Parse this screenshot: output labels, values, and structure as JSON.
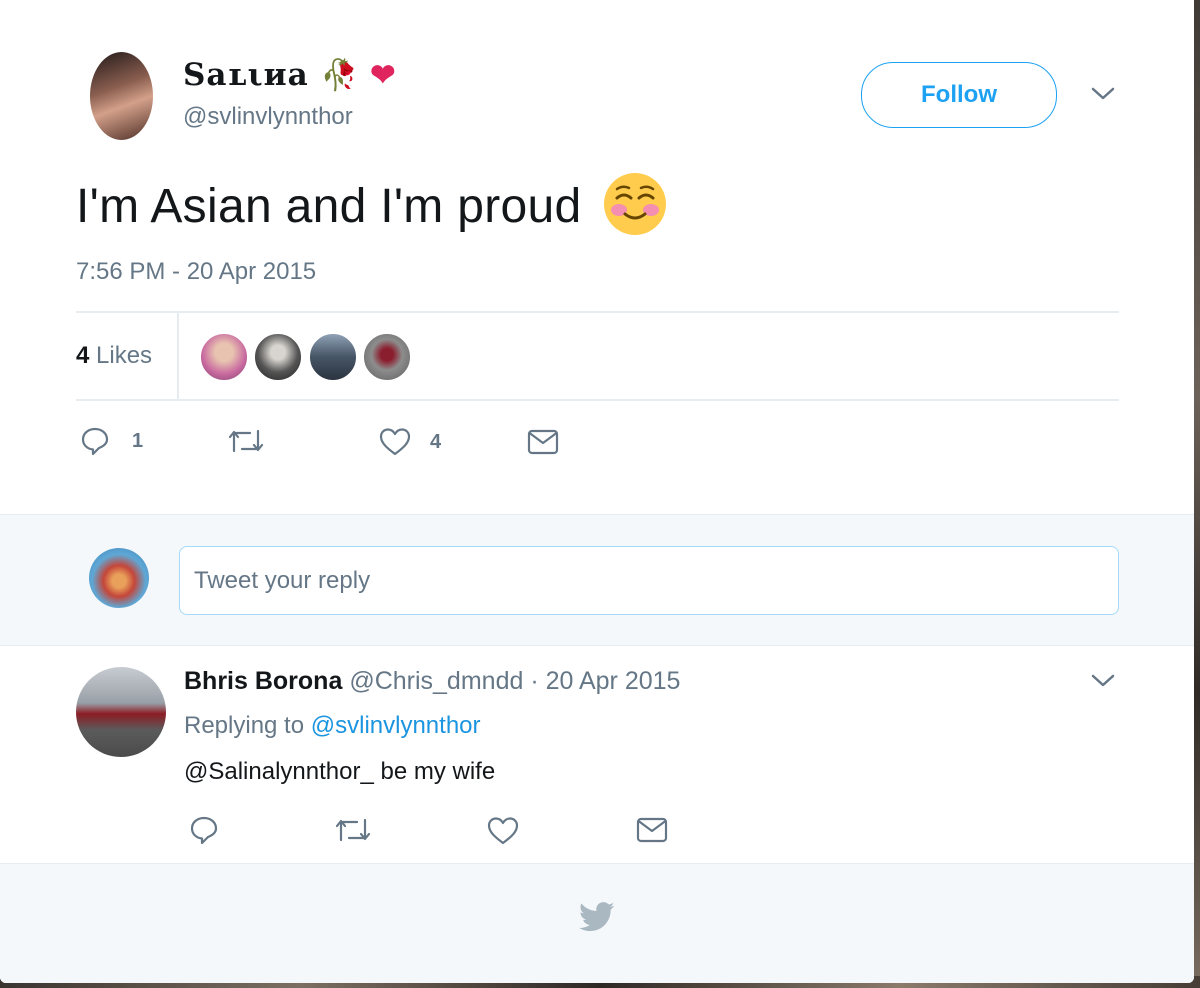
{
  "tweet": {
    "author_name": "Saʟιиa",
    "author_emoji": "🥀 ❤",
    "handle": "@svlinvlynnthor",
    "follow_label": "Follow",
    "text": "I'm Asian and I'm proud",
    "text_emoji": "☺️",
    "timestamp": "7:56 PM - 20 Apr 2015",
    "likes_count": "4",
    "likes_label": "Likes",
    "actions": {
      "reply_count": "1",
      "retweet_count": "",
      "like_count": "4"
    }
  },
  "reply_box": {
    "placeholder": "Tweet your reply"
  },
  "reply": {
    "author_name": "Bhris Borona",
    "handle": "@Chris_dmndd",
    "date": "· 20 Apr 2015",
    "replying_prefix": "Replying to",
    "replying_to": "@svlinvlynnthor",
    "text": "@Salinalynnthor_ be my wife"
  },
  "colors": {
    "accent": "#1da1f2",
    "muted": "#657786",
    "border": "#e6ecf0"
  },
  "icons": [
    "chevron-down-icon",
    "reply-icon",
    "retweet-icon",
    "heart-icon",
    "message-icon",
    "twitter-bird-icon"
  ]
}
